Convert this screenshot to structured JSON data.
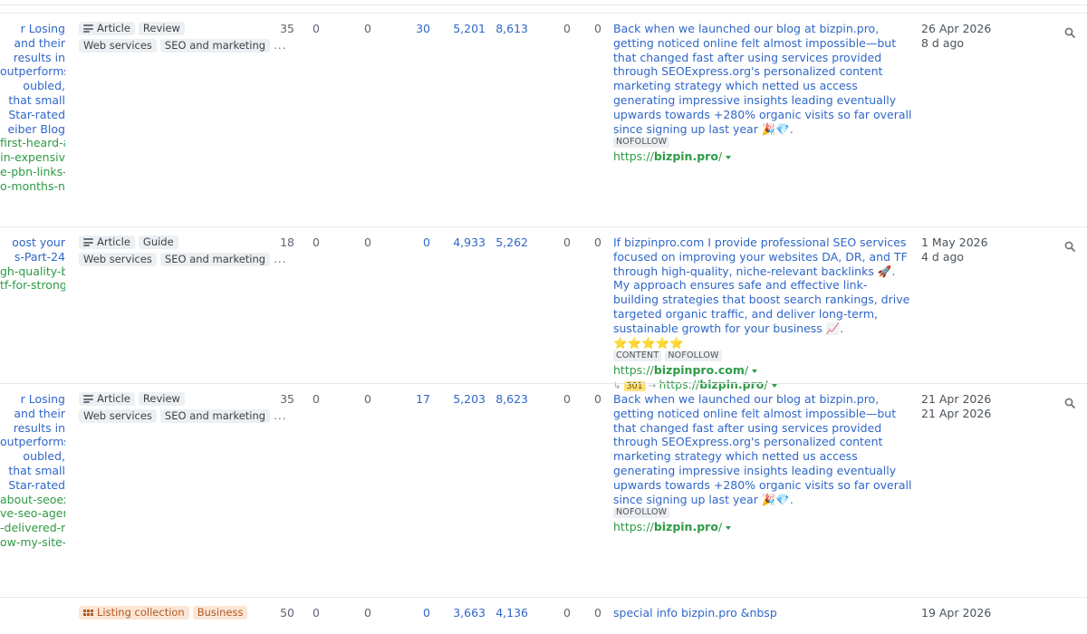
{
  "table": {
    "rows": [
      {
        "title_lines": [
          "r Losing",
          "and their",
          "results in",
          "outperforms",
          "oubled,",
          "that small",
          " Star-rated",
          "eiber Blog"
        ],
        "url_lines": [
          "first-heard-a",
          "in-expensiv",
          "e-pbn-links-",
          "o-months-no"
        ],
        "tags_line1": [
          {
            "icon": "article-icon",
            "label": "Article"
          },
          {
            "label": "Review"
          }
        ],
        "tags_line2": [
          "Web services",
          "SEO and marketing"
        ],
        "more": "...",
        "metrics": [
          "35",
          "0",
          "0",
          "30",
          "5,201",
          "8,613",
          "0",
          "0"
        ],
        "anchor": "Back when we launched our blog at bizpin.pro, getting noticed online felt almost impossible—but that changed fast after using services provided through SEOExpress.org's personalized content marketing strategy which netted us access generating impressive insights leading eventually upwards towards +280% organic visits so far overall since signing up last year 🎉💎.",
        "badges": [
          "NOFOLLOW"
        ],
        "target_prefix": "https://",
        "target_domain": "bizpin.pro",
        "target_suffix": "/",
        "date": "26 Apr 2026",
        "ago": "8 d ago"
      },
      {
        "title_lines": [
          "oost your",
          "s-Part-24"
        ],
        "url_lines": [
          "gh-quality-b",
          "tf-for-strong"
        ],
        "tags_line1": [
          {
            "icon": "article-icon",
            "label": "Article"
          },
          {
            "label": "Guide"
          }
        ],
        "tags_line2": [
          "Web services",
          "SEO and marketing"
        ],
        "more": "...",
        "metrics": [
          "18",
          "0",
          "0",
          "0",
          "4,933",
          "5,262",
          "0",
          "0"
        ],
        "anchor": "If bizpinpro.com I provide professional SEO services focused on improving your websites DA, DR, and TF through high-quality, niche-relevant backlinks 🚀. My approach ensures safe and effective link-building strategies that boost search rankings, drive targeted organic traffic, and deliver long-term, sustainable growth for your business 📈. ⭐⭐⭐⭐⭐",
        "badges": [
          "CONTENT",
          "NOFOLLOW"
        ],
        "target_prefix": "https://",
        "target_domain": "bizpinpro.com",
        "target_suffix": "/",
        "redirect_code": "301",
        "redirect_prefix": "https://",
        "redirect_domain": "bizpin.pro",
        "redirect_suffix": "/",
        "date": "1 May 2026",
        "ago": "4 d ago"
      },
      {
        "title_lines": [
          "r Losing",
          "and their",
          "results in",
          "outperforms",
          "oubled,",
          "that small",
          " Star-rated"
        ],
        "url_lines": [
          "about-seoex",
          "ve-seo-agen",
          "-delivered-r",
          "ow-my-site-"
        ],
        "tags_line1": [
          {
            "icon": "article-icon",
            "label": "Article"
          },
          {
            "label": "Review"
          }
        ],
        "tags_line2": [
          "Web services",
          "SEO and marketing"
        ],
        "more": "...",
        "metrics": [
          "35",
          "0",
          "0",
          "17",
          "5,203",
          "8,623",
          "0",
          "0"
        ],
        "anchor": "Back when we launched our blog at bizpin.pro, getting noticed online felt almost impossible—but that changed fast after using services provided through SEOExpress.org's personalized content marketing strategy which netted us access generating impressive insights leading eventually upwards towards +280% organic visits so far overall since signing up last year 🎉💎.",
        "badges": [
          "NOFOLLOW"
        ],
        "target_prefix": "https://",
        "target_domain": "bizpin.pro",
        "target_suffix": "/",
        "date": "21 Apr 2026",
        "ago": "21 Apr 2026"
      },
      {
        "title_lines": [],
        "url_lines": [],
        "tags_line1": [
          {
            "icon": "listing-icon",
            "label": "Listing collection",
            "orange": true
          },
          {
            "label": "Business",
            "orange": true
          }
        ],
        "tags_line2": [],
        "more": "",
        "metrics": [
          "50",
          "0",
          "0",
          "0",
          "3,663",
          "4,136",
          "0",
          "0"
        ],
        "anchor": "special info bizpin.pro &nbsp",
        "badges": [],
        "target_prefix": "",
        "target_domain": "",
        "target_suffix": "",
        "date": "19 Apr 2026",
        "ago": ""
      }
    ]
  },
  "colors": {
    "link": "#2f67c8",
    "url_green": "#2e9a46",
    "tag_bg": "#edf0f3",
    "redirect_code_bg": "#ffe17a"
  }
}
